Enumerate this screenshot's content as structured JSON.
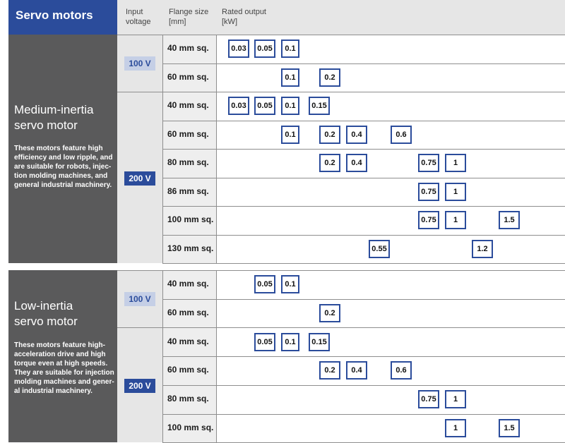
{
  "header": {
    "title": "Servo motors",
    "input_voltage": "Input\nvoltage",
    "flange_size": "Flange size\n[mm]",
    "rated_output": "Rated output\n[kW]"
  },
  "medium": {
    "title_line1": "Medium-inertia",
    "title_line2": "servo motor",
    "description": "These motors feature high efficiency and low ripple, and are suitable for robots, injec-tion molding machines, and general industrial machinery.",
    "voltage_100": "100 V",
    "voltage_200": "200 V",
    "rows": [
      {
        "flange": "40 mm sq.",
        "outputs": [
          "0.03",
          "0.05",
          "0.1"
        ]
      },
      {
        "flange": "60 mm sq.",
        "outputs": [
          "0.1",
          "0.2"
        ]
      },
      {
        "flange": "40 mm sq.",
        "outputs": [
          "0.03",
          "0.05",
          "0.1",
          "0.15"
        ]
      },
      {
        "flange": "60 mm sq.",
        "outputs": [
          "0.1",
          "0.2",
          "0.4",
          "0.6"
        ]
      },
      {
        "flange": "80 mm sq.",
        "outputs": [
          "0.2",
          "0.4",
          "0.75",
          "1"
        ]
      },
      {
        "flange": "86 mm sq.",
        "outputs": [
          "0.75",
          "1"
        ]
      },
      {
        "flange": "100 mm sq.",
        "outputs": [
          "0.75",
          "1",
          "1.5"
        ]
      },
      {
        "flange": "130 mm sq.",
        "outputs": [
          "0.55",
          "1.2"
        ]
      }
    ]
  },
  "low": {
    "title_line1": "Low-inertia",
    "title_line2": "servo motor",
    "description": "These motors feature high-acceleration drive and high torque even at high speeds.\nThey are suitable for injection molding machines and gener-al industrial machinery.",
    "voltage_100": "100 V",
    "voltage_200": "200 V",
    "rows": [
      {
        "flange": "40 mm sq.",
        "outputs": [
          "0.05",
          "0.1"
        ]
      },
      {
        "flange": "60 mm sq.",
        "outputs": [
          "0.2"
        ]
      },
      {
        "flange": "40 mm sq.",
        "outputs": [
          "0.05",
          "0.1",
          "0.15"
        ]
      },
      {
        "flange": "60 mm sq.",
        "outputs": [
          "0.2",
          "0.4",
          "0.6"
        ]
      },
      {
        "flange": "80 mm sq.",
        "outputs": [
          "0.75",
          "1"
        ]
      },
      {
        "flange": "100 mm sq.",
        "outputs": [
          "1",
          "1.5"
        ]
      }
    ]
  },
  "colors": {
    "accent_blue": "#2b4c9b",
    "light_blue": "#c5cfe6",
    "panel_gray": "#5a5a5b"
  }
}
